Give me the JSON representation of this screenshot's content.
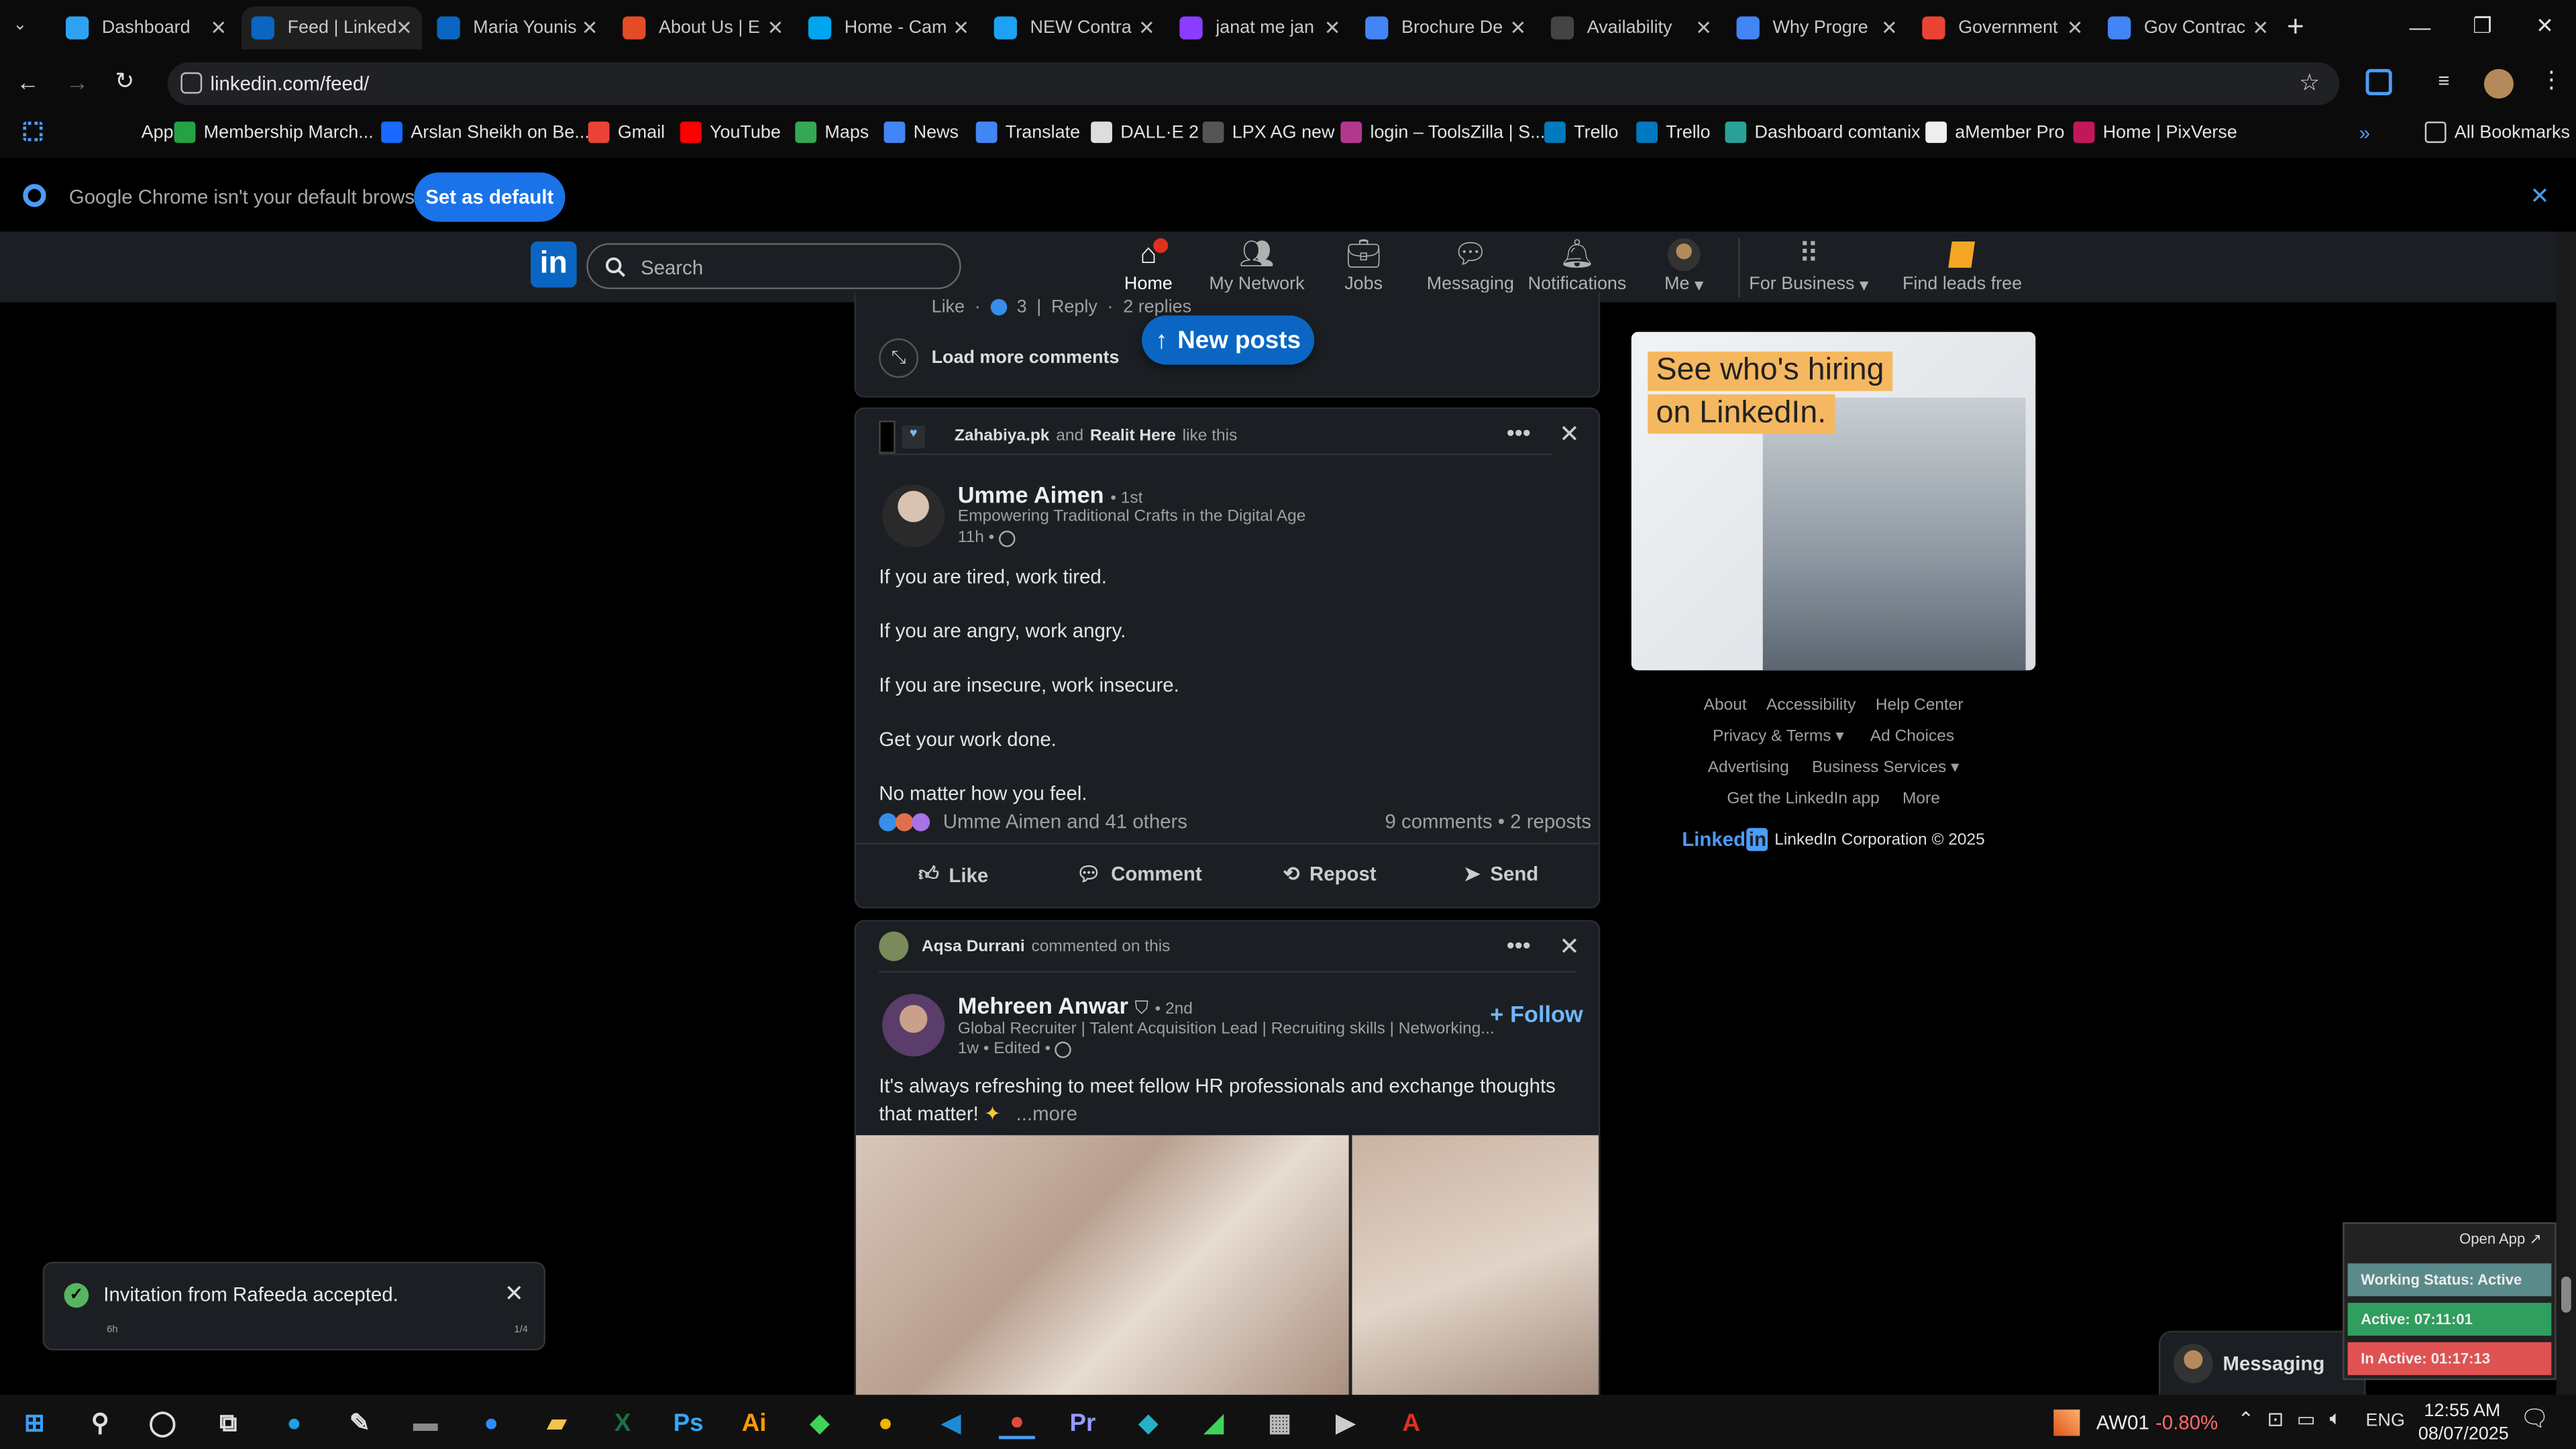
{
  "tabs": [
    {
      "label": "Dashboard",
      "color": "#2ea3f2"
    },
    {
      "label": "Feed | LinkedIn",
      "color": "#0a66c2"
    },
    {
      "label": "Maria Younis",
      "color": "#0a66c2"
    },
    {
      "label": "About Us | E",
      "color": "#e34c26"
    },
    {
      "label": "Home - Cam",
      "color": "#00a4ef"
    },
    {
      "label": "NEW Contra",
      "color": "#1da1f2"
    },
    {
      "label": "janat me jan",
      "color": "#8b3dff"
    },
    {
      "label": "Brochure De",
      "color": "#4285f4"
    },
    {
      "label": "Availability",
      "color": "#444444"
    },
    {
      "label": "Why Progre",
      "color": "#4285f4"
    },
    {
      "label": "Government",
      "color": "#ea4335"
    },
    {
      "label": "Gov Contrac",
      "color": "#4285f4"
    }
  ],
  "browser": {
    "url": "linkedin.com/feed/",
    "bookmarks": [
      "Apps",
      "Membership March...",
      "Arslan Sheikh on Be...",
      "Gmail",
      "YouTube",
      "Maps",
      "News",
      "Translate",
      "DALL·E 2",
      "LPX AG new",
      "login – ToolsZilla | S...",
      "Trello",
      "Trello",
      "Dashboard comtanix",
      "aMember Pro",
      "Home | PixVerse"
    ],
    "all_bookmarks": "All Bookmarks",
    "infobar_text": "Google Chrome isn't your default browser",
    "infobar_button": "Set as default"
  },
  "header": {
    "search_placeholder": "Search",
    "nav": [
      {
        "label": "Home",
        "icon": "home-icon",
        "active": true
      },
      {
        "label": "My Network",
        "icon": "network-icon"
      },
      {
        "label": "Jobs",
        "icon": "jobs-icon"
      },
      {
        "label": "Messaging",
        "icon": "messaging-icon"
      },
      {
        "label": "Notifications",
        "icon": "bell-icon"
      },
      {
        "label": "Me",
        "icon": "avatar"
      },
      {
        "label": "For Business",
        "icon": "grid-icon"
      },
      {
        "label": "Find leads free",
        "icon": "leads-icon"
      }
    ]
  },
  "prev_post": {
    "like": "Like",
    "likes_count": "3",
    "reply": "Reply",
    "replies": "2 replies",
    "load_more": "Load more comments",
    "new_posts": "New posts"
  },
  "post1": {
    "context_a": "Zahabiya.pk",
    "context_and": "and",
    "context_b": "Realit Here",
    "context_action": "like this",
    "author": "Umme Aimen",
    "degree": "• 1st",
    "headline": "Empowering Traditional Crafts in the Digital Age",
    "time": "11h •",
    "lines": [
      "If you are tired, work tired.",
      "If you are angry, work angry.",
      "If you are insecure, work insecure.",
      "Get your work done.",
      "No matter how you feel."
    ],
    "reactions": "Umme Aimen and 41 others",
    "comments_reposts": "9 comments • 2 reposts",
    "actions": [
      "Like",
      "Comment",
      "Repost",
      "Send"
    ]
  },
  "post2": {
    "context_name": "Aqsa Durrani",
    "context_action": "commented on this",
    "author": "Mehreen Anwar",
    "degree": "• 2nd",
    "headline": "Global Recruiter | Talent Acquisition Lead | Recruiting skills | Networking...",
    "time": "1w • Edited •",
    "follow": "Follow",
    "text": "It's always refreshing to meet fellow HR professionals and exchange thoughts that matter!",
    "more": "...more"
  },
  "ad": {
    "line1": "See who's hiring",
    "line2": "on LinkedIn."
  },
  "footer": {
    "row1": [
      "About",
      "Accessibility",
      "Help Center"
    ],
    "row2": [
      "Privacy & Terms",
      "Ad Choices"
    ],
    "row3": [
      "Advertising",
      "Business Services"
    ],
    "row4": [
      "Get the LinkedIn app",
      "More"
    ],
    "corp": "LinkedIn Corporation © 2025",
    "brand": "Linked"
  },
  "toast": {
    "text": "Invitation from Rafeeda accepted.",
    "left_small": "6h",
    "right_small": "1/4"
  },
  "messaging": {
    "label": "Messaging"
  },
  "tracker": {
    "open_app": "Open App ↗",
    "status": "Working Status: Active",
    "active": "Active: 07:11:01",
    "inactive": "In Active: 01:17:13"
  },
  "taskbar": {
    "ticker": "AW01",
    "ticker_change": "-0.80%",
    "lang": "ENG",
    "time": "12:55 AM",
    "date": "08/07/2025"
  },
  "colors": {
    "accent": "#0a66c2",
    "follow": "#71b7fb",
    "new_posts": "#0a66c2"
  }
}
